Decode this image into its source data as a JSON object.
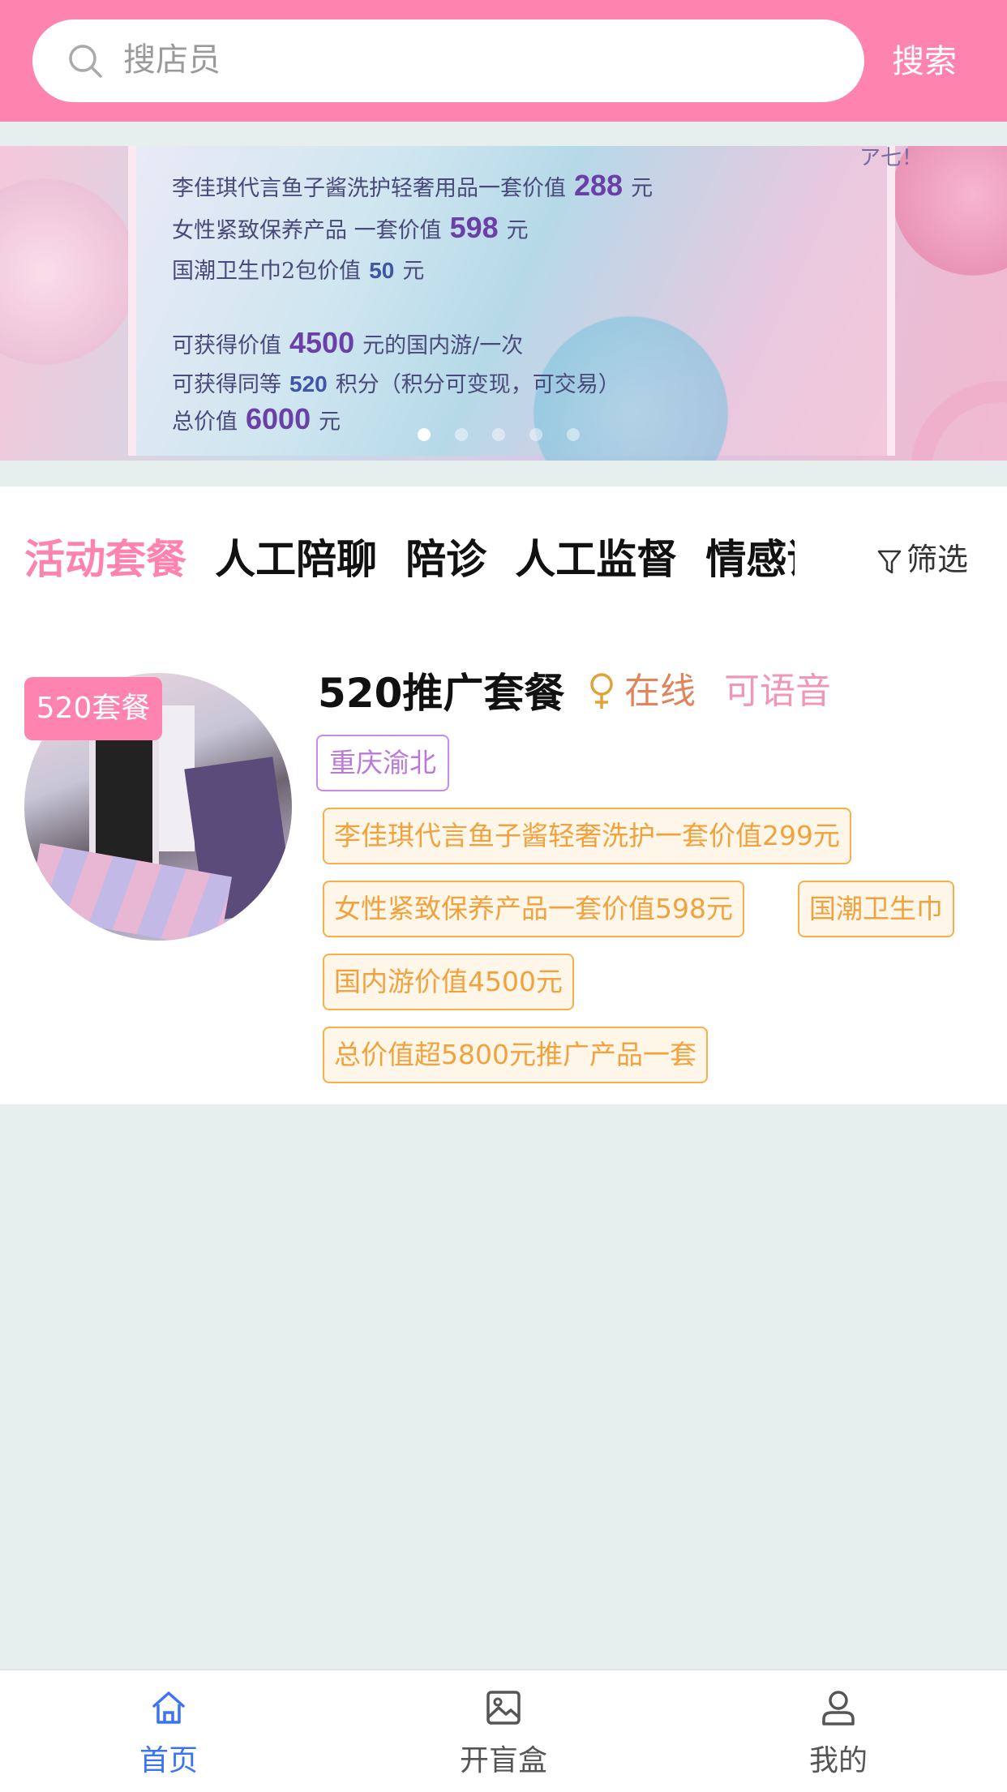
{
  "search": {
    "placeholder": "搜店员",
    "button": "搜索"
  },
  "banner": {
    "lines": [
      {
        "pre": "李佳琪代言鱼子酱洗护轻奢用品一套价值",
        "value": "288",
        "post": "元"
      },
      {
        "pre": "女性紧致保养产品  一套价值",
        "value": "598",
        "post": "元"
      },
      {
        "pre": "国潮卫生巾2包价值",
        "value": "50",
        "post": "元"
      },
      {
        "pre": "可获得价值",
        "value": "4500",
        "post": "元的国内游/一次"
      },
      {
        "pre": "可获得同等",
        "value": "520",
        "post": "积分（积分可变现，可交易）"
      },
      {
        "pre": "总价值",
        "value": "6000",
        "post": "元"
      }
    ],
    "corner_text": "ア七！",
    "active_slide": 1,
    "slide_count": 5
  },
  "tabs": [
    "活动套餐",
    "人工陪聊",
    "陪诊",
    "人工监督",
    "情感谘"
  ],
  "filter": {
    "label": "筛选"
  },
  "item": {
    "badge": "520套餐",
    "title": "520推广套餐",
    "status": "在线",
    "voice": "可语音",
    "location": "重庆渝北",
    "tags": [
      "李佳琪代言鱼子酱轻奢洗护一套价值299元",
      "女性紧致保养产品一套价值598元",
      "国潮卫生巾",
      "国内游价值4500元",
      "总价值超5800元推广产品一套"
    ]
  },
  "nav": [
    {
      "label": "首页",
      "icon": "home-icon",
      "active": true
    },
    {
      "label": "开盲盒",
      "icon": "image-icon",
      "active": false
    },
    {
      "label": "我的",
      "icon": "user-icon",
      "active": false
    }
  ],
  "colors": {
    "accent": "#fe83ae",
    "tag_border": "#f5b04a",
    "location_border": "#c98be6",
    "nav_active": "#3b73f0"
  }
}
